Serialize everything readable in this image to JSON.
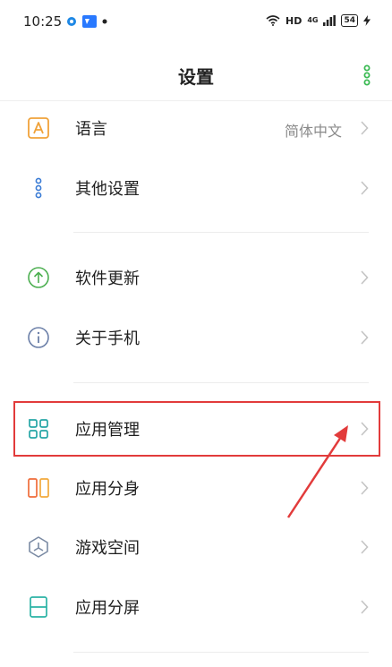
{
  "status_bar": {
    "time": "10:25",
    "right_text": "HD",
    "battery": "54",
    "network": "4G",
    "left_icons": [
      "app-notification-icon",
      "image-notification-icon",
      "dot-icon"
    ]
  },
  "header": {
    "title": "设置",
    "more_icon": "vertical-dots-icon",
    "accent": "#3cba54"
  },
  "rows": [
    {
      "label": "语言",
      "value": "简体中文",
      "icon": "language-a-icon"
    },
    {
      "label": "其他设置",
      "value": "",
      "icon": "other-settings-dots-icon"
    },
    {
      "label": "软件更新",
      "value": "",
      "icon": "update-arrow-icon"
    },
    {
      "label": "关于手机",
      "value": "",
      "icon": "info-icon"
    },
    {
      "label": "应用管理",
      "value": "",
      "icon": "app-management-grid-icon"
    },
    {
      "label": "应用分身",
      "value": "",
      "icon": "app-clone-icon"
    },
    {
      "label": "游戏空间",
      "value": "",
      "icon": "game-space-icon"
    },
    {
      "label": "应用分屏",
      "value": "",
      "icon": "split-screen-icon"
    }
  ],
  "annotation": {
    "highlight_color": "#e23b3b",
    "highlighted_item": "应用管理"
  }
}
